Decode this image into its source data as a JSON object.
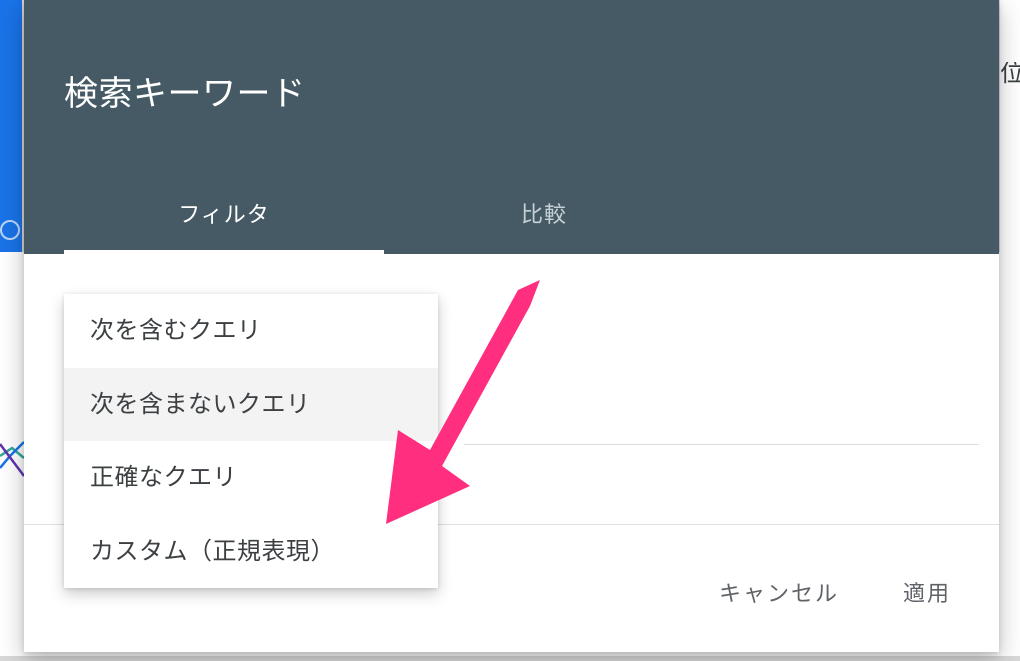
{
  "dialog": {
    "title": "検索キーワード",
    "tabs": [
      {
        "label": "フィルタ",
        "active": true
      },
      {
        "label": "比較",
        "active": false
      }
    ],
    "dropdown_options": [
      {
        "label": "次を含むクエリ",
        "highlighted": false
      },
      {
        "label": "次を含まないクエリ",
        "highlighted": true
      },
      {
        "label": "正確なクエリ",
        "highlighted": false
      },
      {
        "label": "カスタム（正規表現）",
        "highlighted": false
      }
    ],
    "actions": {
      "cancel": "キャンセル",
      "apply": "適用"
    }
  },
  "background_fragment": "位"
}
